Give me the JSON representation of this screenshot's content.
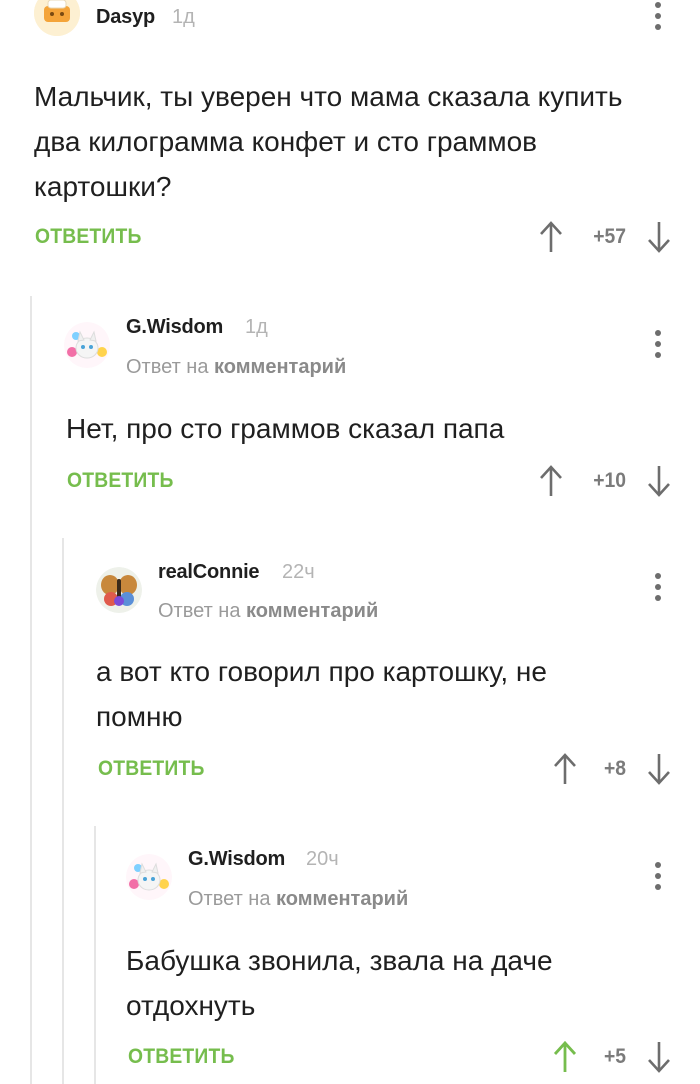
{
  "comments": [
    {
      "username": "Dasyp",
      "time": "1д",
      "reply_prefix": "",
      "reply_target": "",
      "text": "Мальчик, ты уверен что мама сказала купить два килограмма конфет и сто граммов картошки?",
      "reply_label": "ОТВЕТИТЬ",
      "rating": "+57",
      "upvoted": false
    },
    {
      "username": "G.Wisdom",
      "time": "1д",
      "reply_prefix": "Ответ на",
      "reply_target": "комментарий",
      "text": "Нет, про сто граммов сказал папа",
      "reply_label": "ОТВЕТИТЬ",
      "rating": "+10",
      "upvoted": false
    },
    {
      "username": "realConnie",
      "time": "22ч",
      "reply_prefix": "Ответ на",
      "reply_target": "комментарий",
      "text": "а вот кто говорил про картошку, не помню",
      "reply_label": "ОТВЕТИТЬ",
      "rating": "+8",
      "upvoted": false
    },
    {
      "username": "G.Wisdom",
      "time": "20ч",
      "reply_prefix": "Ответ на",
      "reply_target": "комментарий",
      "text": "Бабушка звонила, звала на даче отдохнуть",
      "reply_label": "ОТВЕТИТЬ",
      "rating": "+5",
      "upvoted": true
    }
  ],
  "colors": {
    "accent_green": "#76bd4d",
    "icon_gray": "#6d6d6d",
    "text": "#1f1f1f",
    "muted": "#9a9a9a",
    "thread_line": "#e6e6e6"
  },
  "icons": {
    "more": "more-vertical-icon",
    "up": "arrow-up-icon",
    "down": "arrow-down-icon"
  }
}
